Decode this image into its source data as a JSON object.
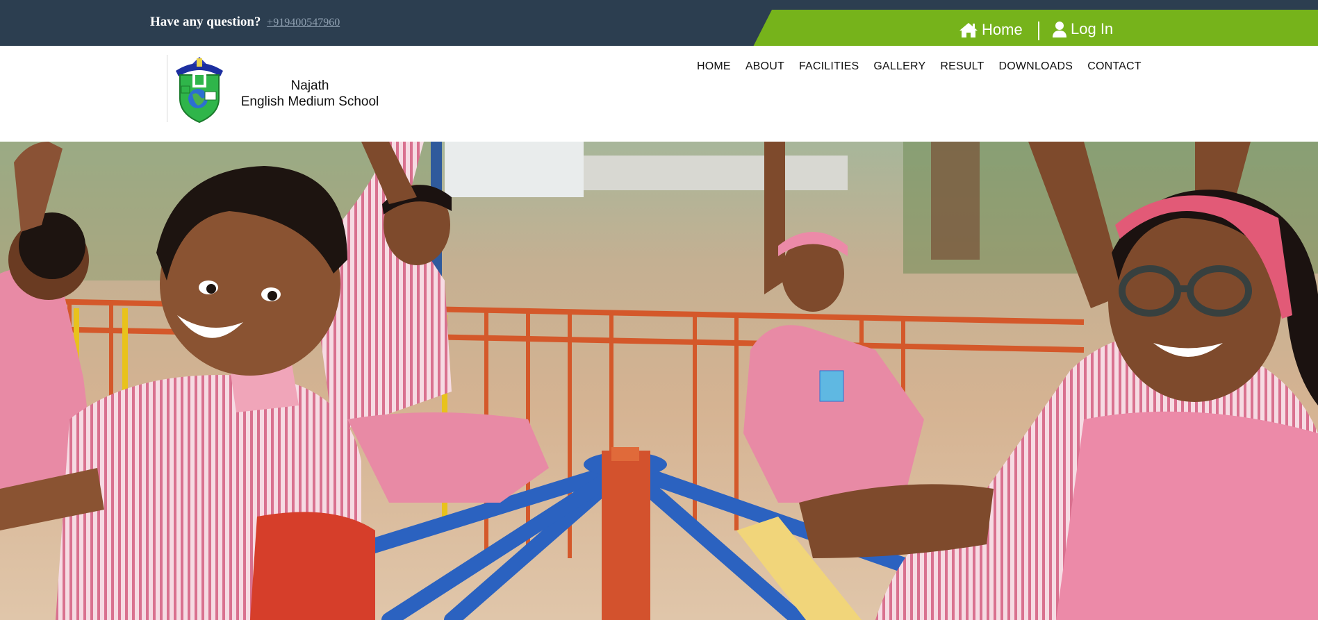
{
  "topbar": {
    "question": "Have any question?",
    "phone": "+919400547960",
    "home_label": "Home",
    "login_label": "Log In"
  },
  "brand": {
    "line1": "Najath",
    "line2": "English Medium School"
  },
  "nav": {
    "items": [
      "HOME",
      "ABOUT",
      "FACILITIES",
      "GALLERY",
      "RESULT",
      "DOWNLOADS",
      "CONTACT"
    ]
  },
  "colors": {
    "topbar": "#2c3e50",
    "accent_green": "#76b31b",
    "uniform_pink": "#e88aa5"
  },
  "icons": [
    "home-icon",
    "user-icon",
    "school-logo"
  ]
}
